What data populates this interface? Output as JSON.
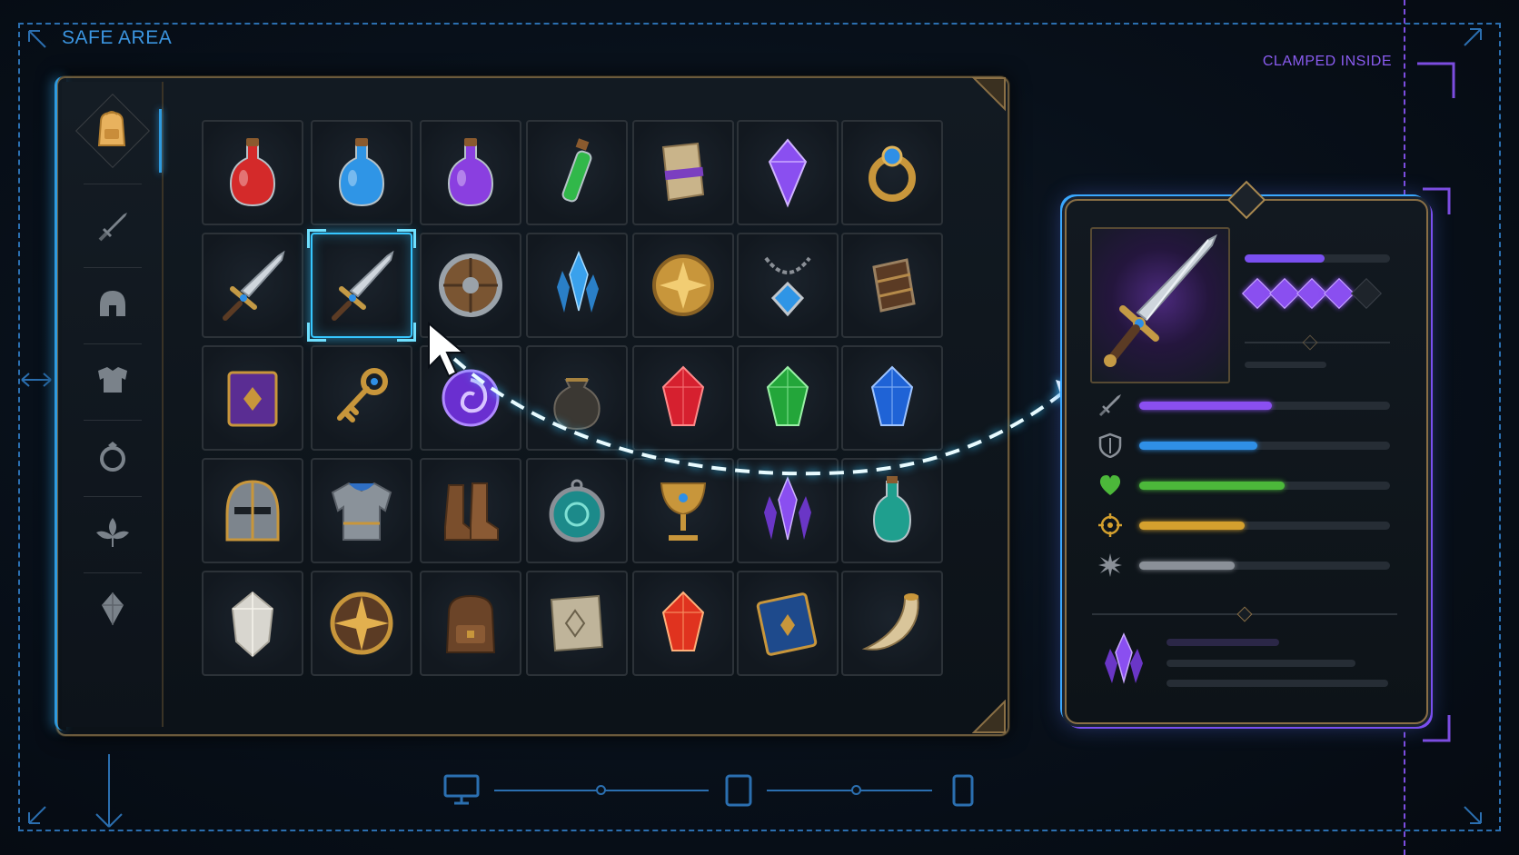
{
  "labels": {
    "safe_area": "SAFE AREA",
    "clamped": "CLAMPED INSIDE"
  },
  "colors": {
    "safe_area": "#2b6fb0",
    "clamp_line": "#7c4de0",
    "selection": "#36c6ff",
    "frame_gold": "#8a6f45"
  },
  "sidebar": {
    "active_index": 0,
    "tabs": [
      {
        "name": "backpack-icon"
      },
      {
        "name": "sword-icon"
      },
      {
        "name": "helmet-icon"
      },
      {
        "name": "chest-armor-icon"
      },
      {
        "name": "ring-icon"
      },
      {
        "name": "herb-leaf-icon"
      },
      {
        "name": "crystal-icon"
      }
    ]
  },
  "inventory": {
    "columns": 7,
    "rows": 5,
    "selected": [
      1,
      1
    ],
    "items": [
      [
        "red-potion-icon",
        "blue-potion-icon",
        "purple-potion-icon",
        "green-vial-icon",
        "scroll-icon",
        "purple-crystal-icon",
        "gold-ring-icon"
      ],
      [
        "steel-sword-icon",
        "steel-sword-icon",
        "round-shield-icon",
        "blue-crystal-cluster-icon",
        "gold-compass-coin-icon",
        "sapphire-amulet-icon",
        "leather-bracer-icon"
      ],
      [
        "purple-spellbook-icon",
        "gold-key-icon",
        "arcane-orb-icon",
        "coin-pouch-icon",
        "ruby-gem-icon",
        "emerald-gem-icon",
        "sapphire-gem-icon"
      ],
      [
        "knight-helmet-icon",
        "plate-armor-icon",
        "leather-boots-icon",
        "teal-amulet-icon",
        "gold-chalice-icon",
        "amethyst-cluster-icon",
        "teal-potion-icon"
      ],
      [
        "white-quartz-icon",
        "gold-compass-icon",
        "leather-backpack-icon",
        "map-scroll-icon",
        "fire-ruby-icon",
        "blue-tome-icon",
        "drinking-horn-icon"
      ]
    ]
  },
  "detail": {
    "item": "steel-sword-icon",
    "header_bar_fill": 0.55,
    "rating": {
      "filled": 4,
      "total": 5
    },
    "stats": [
      {
        "icon": "sword-icon",
        "fill": 0.53,
        "color": "#8a4ff0"
      },
      {
        "icon": "shield-icon",
        "fill": 0.47,
        "color": "#2f8fe6"
      },
      {
        "icon": "heart-icon",
        "fill": 0.58,
        "color": "#4cb83a"
      },
      {
        "icon": "crosshair-icon",
        "fill": 0.42,
        "color": "#d4a02e"
      },
      {
        "icon": "starburst-icon",
        "fill": 0.38,
        "color": "#8a9098"
      }
    ],
    "footer_icon": "amethyst-cluster-icon"
  },
  "devices": [
    {
      "name": "desktop-icon"
    },
    {
      "name": "tablet-icon"
    },
    {
      "name": "phone-icon"
    }
  ]
}
